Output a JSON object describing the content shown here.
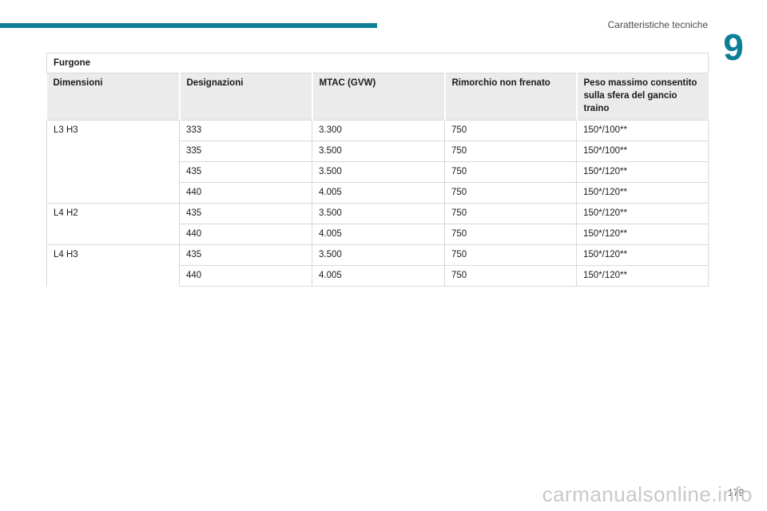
{
  "header": {
    "section_title": "Caratteristiche tecniche",
    "chapter_number": "9"
  },
  "table": {
    "group_title": "Furgone",
    "columns": [
      "Dimensioni",
      "Designazioni",
      "MTAC (GVW)",
      "Rimorchio non frenato",
      "Peso massimo consentito sulla sfera del gancio traino"
    ],
    "groups": [
      {
        "dimension": "L3 H3",
        "rows": [
          [
            "333",
            "3.300",
            "750",
            "150*/100**"
          ],
          [
            "335",
            "3.500",
            "750",
            "150*/100**"
          ],
          [
            "435",
            "3.500",
            "750",
            "150*/120**"
          ],
          [
            "440",
            "4.005",
            "750",
            "150*/120**"
          ]
        ]
      },
      {
        "dimension": "L4 H2",
        "rows": [
          [
            "435",
            "3.500",
            "750",
            "150*/120**"
          ],
          [
            "440",
            "4.005",
            "750",
            "150*/120**"
          ]
        ]
      },
      {
        "dimension": "L4 H3",
        "rows": [
          [
            "435",
            "3.500",
            "750",
            "150*/120**"
          ],
          [
            "440",
            "4.005",
            "750",
            "150*/120**"
          ]
        ]
      }
    ]
  },
  "footer": {
    "page_number": "179",
    "watermark": "carmanualsonline.info"
  }
}
